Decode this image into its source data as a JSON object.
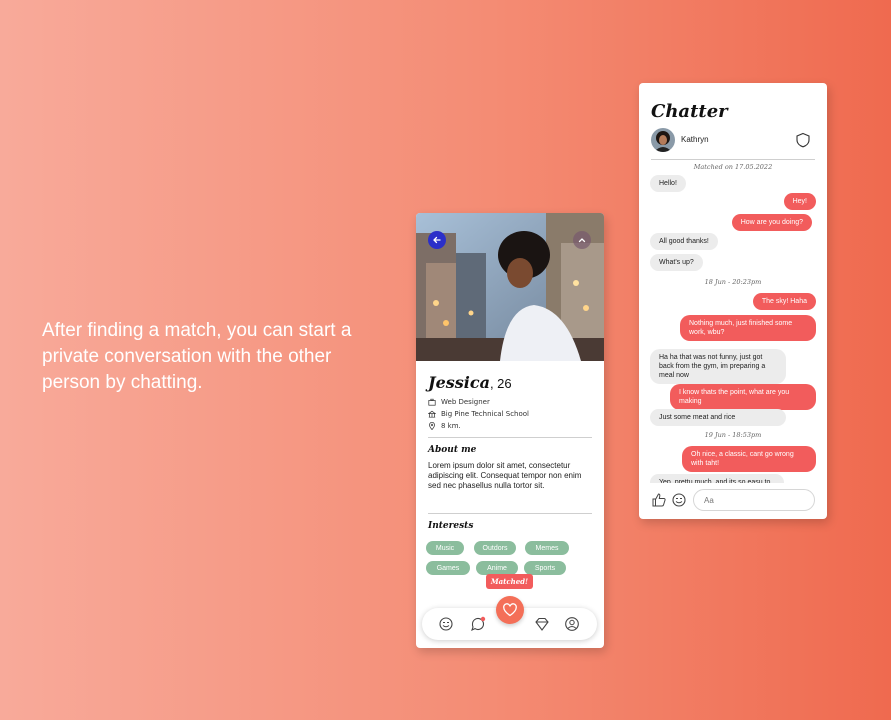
{
  "tagline": "After finding a match, you can start a private conversation with the other person by chatting.",
  "profile": {
    "name": "Jessica",
    "age": ", 26",
    "job": "Web Designer",
    "school": "Big Pine Technical School",
    "distance": "8 km.",
    "about_title": "About me",
    "about_text": "Lorem ipsum dolor sit amet, consectetur adipiscing elit. Consequat tempor non enim sed nec phasellus nulla tortor sit.",
    "interests_title": "Interests",
    "interests": [
      "Music",
      "Outdors",
      "Memes",
      "Games",
      "Anime",
      "Sports"
    ],
    "matched_label": "Matched!"
  },
  "chat": {
    "title": "Chatter",
    "contact": "Kathryn",
    "matched_on": "Matched on 17.05.2022",
    "messages": [
      {
        "side": "in",
        "text": "Hello!"
      },
      {
        "side": "out",
        "text": "Hey!"
      },
      {
        "side": "out",
        "text": "How are you doing?"
      },
      {
        "side": "in",
        "text": "All good thanks!"
      },
      {
        "side": "in",
        "text": "What's up?"
      },
      {
        "side": "out",
        "text": "The sky! Haha"
      },
      {
        "side": "out",
        "text": "Nothing much, just finished some work, wbu?"
      },
      {
        "side": "in",
        "text": "Ha ha that was not funny, just got back from the gym, im preparing a meal now"
      },
      {
        "side": "out",
        "text": "I know thats the point, what are you making"
      },
      {
        "side": "in",
        "text": "Just some meat and rice"
      },
      {
        "side": "out",
        "text": "Oh nice, a classic, cant go wrong with taht!"
      },
      {
        "side": "in",
        "text": "Yep, prettu much, and its so easu to"
      }
    ],
    "stamps": [
      "18 Jun - 20:23pm",
      "19 Jun - 18:53pm"
    ],
    "input_placeholder": "Aa"
  },
  "colors": {
    "accent": "#f25c5c",
    "chip": "#8bbd9d",
    "nav_heart": "#f46f58"
  },
  "icons": [
    "back-arrow-icon",
    "chevron-up-icon",
    "briefcase-icon",
    "school-icon",
    "location-pin-icon",
    "smiley-icon",
    "chat-icon",
    "heart-icon",
    "diamond-icon",
    "user-icon",
    "shield-icon",
    "thumbs-up-icon"
  ]
}
